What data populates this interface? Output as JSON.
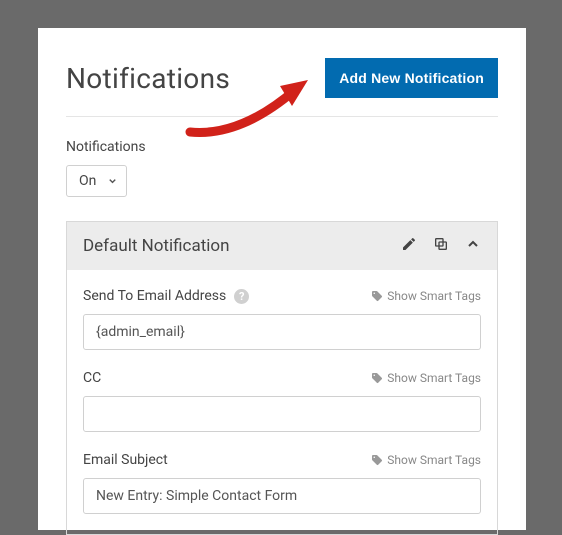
{
  "header": {
    "title": "Notifications",
    "add_button": "Add New Notification"
  },
  "toggle": {
    "label": "Notifications",
    "value": "On"
  },
  "card": {
    "title": "Default Notification"
  },
  "fields": {
    "send_to": {
      "label": "Send To Email Address",
      "value": "{admin_email}"
    },
    "cc": {
      "label": "CC",
      "value": ""
    },
    "subject": {
      "label": "Email Subject",
      "value": "New Entry: Simple Contact Form"
    }
  },
  "smart_tags_label": "Show Smart Tags"
}
